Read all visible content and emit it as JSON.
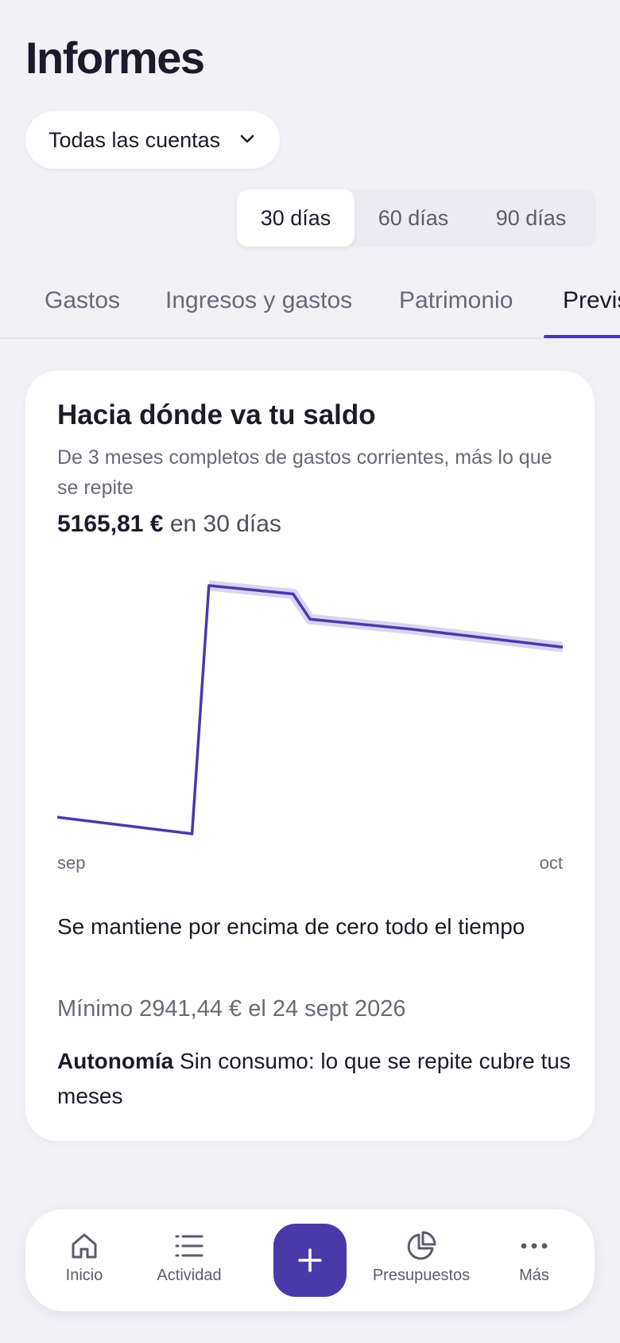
{
  "header": {
    "title": "Informes"
  },
  "account_select": {
    "value": "Todas las cuentas",
    "icon": "chevron-down-icon"
  },
  "range": {
    "options": [
      "30 días",
      "60 días",
      "90 días"
    ],
    "selected": "30 días"
  },
  "tabs": {
    "items": [
      "Gastos",
      "Ingresos y gastos",
      "Patrimonio",
      "Previsión"
    ],
    "active": "Previsión"
  },
  "card": {
    "title": "Hacia dónde va tu saldo",
    "subtitle": "De 3 meses completos de gastos corrientes, más lo que se repite",
    "balance_value": "5165,81 €",
    "balance_suffix": "en 30 días",
    "status": "Se mantiene por encima de cero todo el tiempo",
    "minimum": "Mínimo 2941,44 € el 24 sept 2026",
    "autonomy_label": "Autonomía",
    "autonomy_text": "Sin consumo: lo que se repite cubre tus meses"
  },
  "chart_data": {
    "type": "line",
    "x_labels": [
      "sep",
      "oct"
    ],
    "x": [
      0,
      8,
      9,
      14,
      15,
      21,
      30
    ],
    "series": [
      {
        "values": [
          3140,
          2941.44,
          5900,
          5800,
          5500,
          5380,
          5165.81
        ]
      }
    ],
    "band_series_from_index": 2,
    "colors": {
      "line": "#4a3aa8",
      "band": "#d9d4f2"
    },
    "grid": false
  },
  "bottom_nav": {
    "items": [
      {
        "label": "Inicio",
        "icon": "home-icon"
      },
      {
        "label": "Actividad",
        "icon": "list-icon"
      },
      {
        "label": "Presupuestos",
        "icon": "pie-chart-icon"
      },
      {
        "label": "Más",
        "icon": "more-dots-icon"
      }
    ],
    "fab_icon": "plus-icon"
  },
  "colors": {
    "accent": "#4a3aa8",
    "background": "#f2f1f6",
    "card": "#ffffff"
  }
}
